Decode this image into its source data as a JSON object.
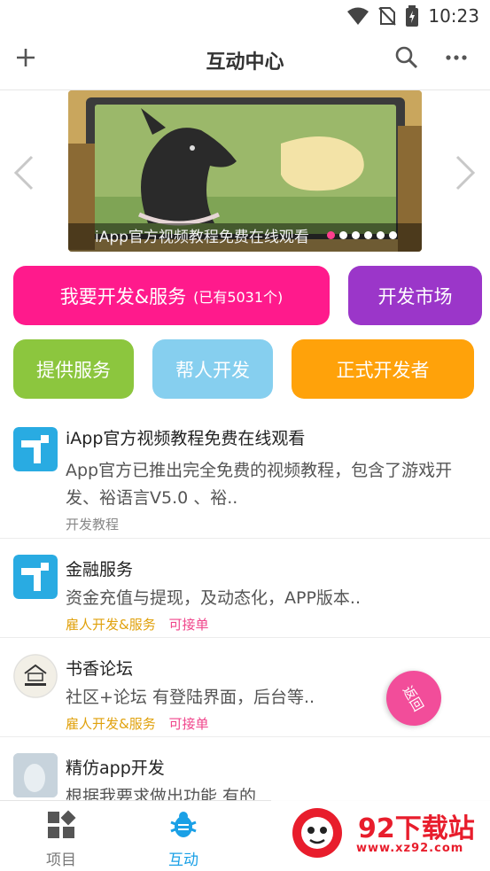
{
  "status_bar": {
    "time": "10:23"
  },
  "app_bar": {
    "title": "互动中心"
  },
  "banner": {
    "caption": "iApp官方视频教程免费在线观看",
    "dot_count": 6,
    "active_dot": 0
  },
  "actions": {
    "develop_service": {
      "label": "我要开发&服务",
      "count_text": "(已有5031个)",
      "color": "#ff1a8c"
    },
    "market": {
      "label": "开发市场",
      "color": "#9b36c9"
    },
    "provide_service": {
      "label": "提供服务",
      "color": "#8cc63e"
    },
    "help_develop": {
      "label": "帮人开发",
      "color": "#86cfef"
    },
    "official_dev": {
      "label": "正式开发者",
      "color": "#ffa20a"
    }
  },
  "feed": [
    {
      "title": "iApp官方视频教程免费在线观看",
      "desc": "App官方已推出完全免费的视频教程，包含了游戏开发、裕语言V5.0 、裕..",
      "category": "开发教程"
    },
    {
      "title": "金融服务",
      "desc": "资金充值与提现，及动态化，APP版本..",
      "tag_role": "雇人开发&服务",
      "tag_status": "可接单"
    },
    {
      "title": "书香论坛",
      "desc": "社区+论坛 有登陆界面，后台等..",
      "tag_role": "雇人开发&服务",
      "tag_status": "可接单"
    },
    {
      "title": "精仿app开发",
      "desc": "根据我要求做出功能 有的"
    }
  ],
  "fab": {
    "label": "返回"
  },
  "tabs": [
    {
      "label": "项目",
      "icon": "grid-icon"
    },
    {
      "label": "互动",
      "icon": "bug-icon"
    }
  ],
  "watermark": {
    "title": "92下载站",
    "url": "www.xz92.com"
  },
  "colors": {
    "accent": "#1aa0e6",
    "tab_inactive": "#777777"
  }
}
